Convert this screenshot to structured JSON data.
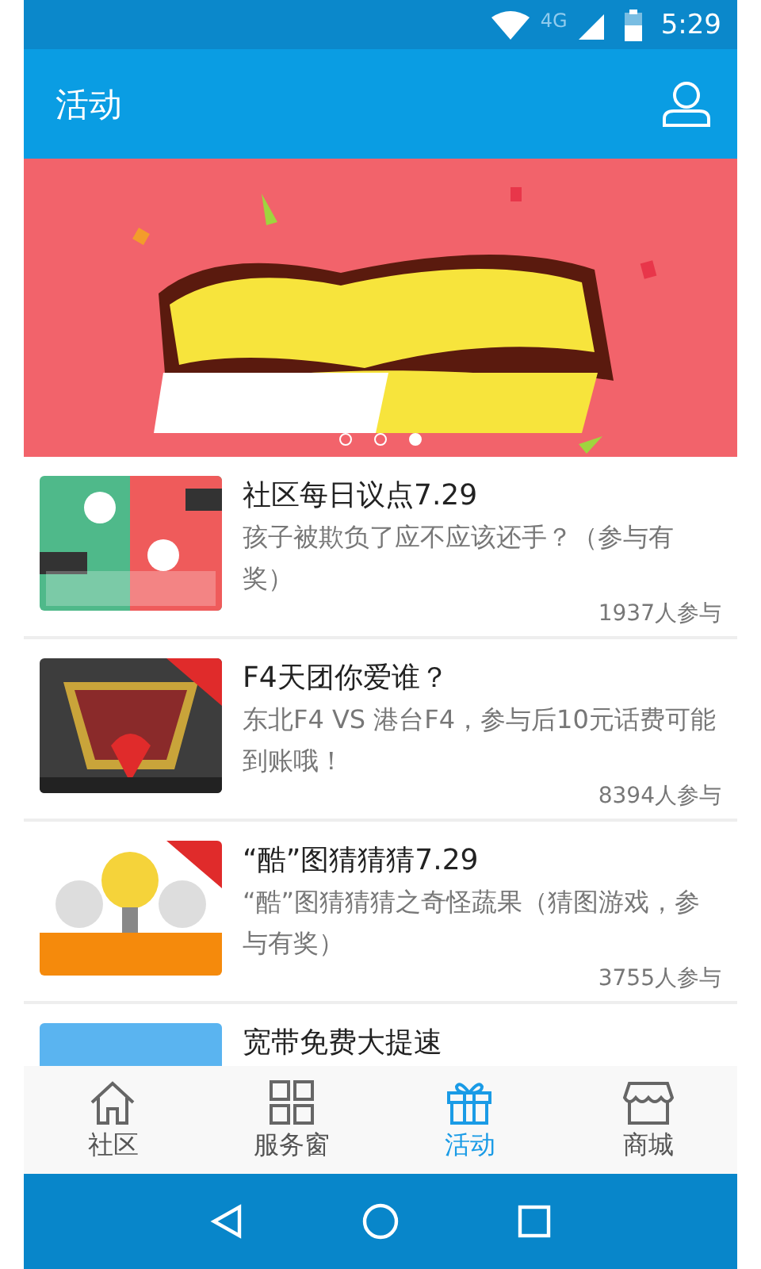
{
  "status_bar": {
    "network": "4G",
    "time": "5:29"
  },
  "app_bar": {
    "title": "活动"
  },
  "banner": {
    "kind": "picture",
    "pages": [
      {
        "selected": false
      },
      {
        "selected": false
      },
      {
        "selected": true
      }
    ]
  },
  "activities": [
    {
      "title": "社区每日议点7.29",
      "description": "孩子被欺负了应不应该还手？（参与有奖）",
      "participants": "1937人参与"
    },
    {
      "title": "F4天团你爱谁？",
      "description": "东北F4 VS 港台F4，参与后10元话费可能到账哦！",
      "participants": "8394人参与"
    },
    {
      "title": "“酷”图猜猜猜7.29",
      "description": "“酷”图猜猜猜之奇怪蔬果（猜图游戏，参与有奖）",
      "participants": "3755人参与"
    },
    {
      "title": "宽带免费大提速"
    }
  ],
  "tab_bar": [
    {
      "label": "社区",
      "selected": false
    },
    {
      "label": "服务窗",
      "selected": false
    },
    {
      "label": "活动",
      "selected": true
    },
    {
      "label": "商城",
      "selected": false
    }
  ]
}
